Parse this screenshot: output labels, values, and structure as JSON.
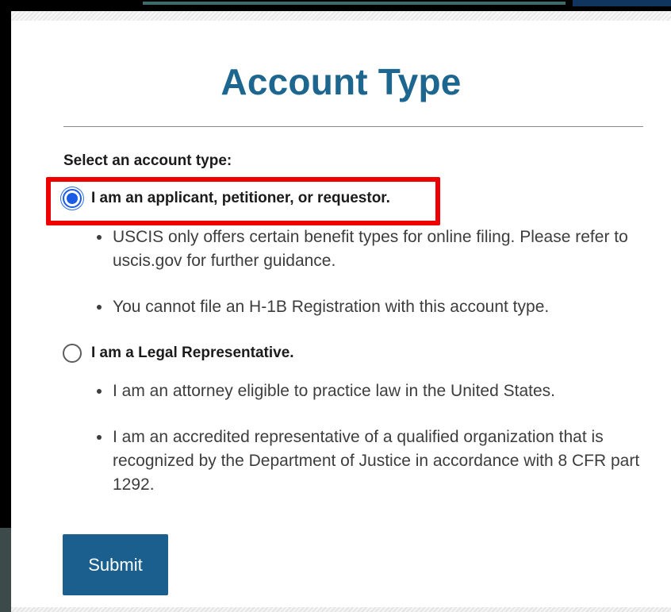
{
  "modal": {
    "title": "Account Type",
    "select_label": "Select an account type:"
  },
  "options": [
    {
      "label": "I am an applicant, petitioner, or requestor.",
      "selected": true,
      "bullets": [
        "USCIS only offers certain benefit types for online filing. Please refer to uscis.gov for further guidance.",
        "You cannot file an H-1B Registration with this account type."
      ]
    },
    {
      "label": "I am a Legal Representative.",
      "selected": false,
      "bullets": [
        "I am an attorney eligible to practice law in the United States.",
        "I am an accredited representative of a qualified organization that is recognized by the Department of Justice in accordance with 8 CFR part 1292."
      ]
    }
  ],
  "submit_label": "Submit",
  "colors": {
    "title": "#1d6690",
    "button": "#1a5f8e",
    "radio_selected": "#1a5ce6",
    "highlight": "#ee0000"
  }
}
